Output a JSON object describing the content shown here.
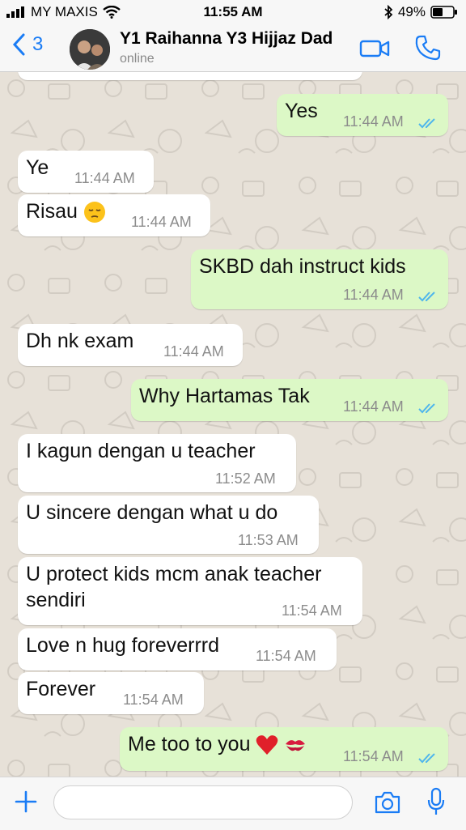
{
  "status_bar": {
    "carrier": "MY MAXIS",
    "time": "11:55 AM",
    "battery": "49%"
  },
  "header": {
    "back_count": "3",
    "contact_name": "Y1 Raihanna Y3 Hijjaz Dad",
    "status": "online",
    "accent_color": "#1a7cf5"
  },
  "messages": [
    {
      "direction": "out",
      "text": "Yes",
      "time": "11:44 AM",
      "read": true
    },
    {
      "direction": "in",
      "text": "Ye",
      "time": "11:44 AM"
    },
    {
      "direction": "in",
      "text": "Risau",
      "emoji": "pensive-face-icon",
      "time": "11:44 AM"
    },
    {
      "direction": "out",
      "text": "SKBD dah instruct kids",
      "time": "11:44 AM",
      "read": true
    },
    {
      "direction": "in",
      "text": "Dh nk exam",
      "time": "11:44 AM"
    },
    {
      "direction": "out",
      "text": "Why Hartamas Tak",
      "time": "11:44 AM",
      "read": true
    },
    {
      "direction": "in",
      "text": "I kagun dengan u  teacher",
      "time": "11:52 AM"
    },
    {
      "direction": "in",
      "text": "U sincere dengan what u do",
      "time": "11:53 AM"
    },
    {
      "direction": "in",
      "text": "U protect kids mcm anak teacher",
      "text_line2": "sendiri",
      "time": "11:54 AM"
    },
    {
      "direction": "in",
      "text": "Love n hug foreverrrd",
      "time": "11:54 AM"
    },
    {
      "direction": "in",
      "text": "Forever",
      "time": "11:54 AM"
    },
    {
      "direction": "out",
      "text": "Me too to you",
      "emoji": "heart-and-kiss-icons",
      "time": "11:54 AM",
      "read": true
    }
  ],
  "input": {
    "value": "",
    "placeholder": ""
  },
  "colors": {
    "outgoing_bubble": "#dcf8c6",
    "incoming_bubble": "#ffffff",
    "read_ticks": "#4fb6ec",
    "chat_background": "#e5ddd5"
  }
}
